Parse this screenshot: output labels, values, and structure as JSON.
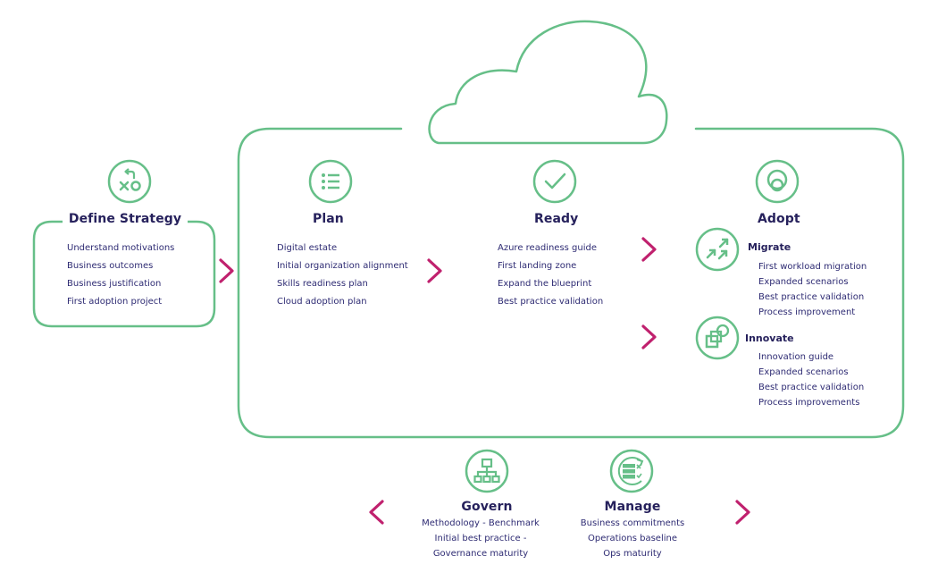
{
  "colors": {
    "accent_green": "#66bf88",
    "chevron_magenta": "#c0216e",
    "text_navy": "#2b2a6b"
  },
  "define_strategy": {
    "icon": "strategy-xo-icon",
    "title": "Define Strategy",
    "items": [
      "Understand motivations",
      "Business outcomes",
      "Business justification",
      "First adoption project"
    ]
  },
  "plan": {
    "icon": "list-icon",
    "title": "Plan",
    "items": [
      "Digital estate",
      "Initial organization alignment",
      "Skills readiness plan",
      "Cloud adoption plan"
    ]
  },
  "ready": {
    "icon": "checkmark-icon",
    "title": "Ready",
    "items": [
      "Azure readiness guide",
      "First landing zone",
      "Expand the blueprint",
      "Best practice validation"
    ]
  },
  "adopt": {
    "icon": "adopt-circles-icon",
    "title": "Adopt",
    "migrate": {
      "icon": "migrate-arrows-icon",
      "title": "Migrate",
      "items": [
        "First workload migration",
        "Expanded scenarios",
        "Best practice validation",
        "Process improvement"
      ]
    },
    "innovate": {
      "icon": "innovate-shapes-icon",
      "title": "Innovate",
      "items": [
        "Innovation guide",
        "Expanded scenarios",
        "Best practice validation",
        "Process improvements"
      ]
    }
  },
  "govern": {
    "icon": "hierarchy-icon",
    "title": "Govern",
    "items": [
      "Methodology - Benchmark",
      "Initial best practice -",
      "Governance maturity"
    ]
  },
  "manage": {
    "icon": "database-cycle-icon",
    "title": "Manage",
    "items": [
      "Business commitments",
      "Operations baseline",
      "Ops maturity"
    ]
  },
  "chevrons": [
    "chevron-right-icon",
    "chevron-left-icon"
  ]
}
